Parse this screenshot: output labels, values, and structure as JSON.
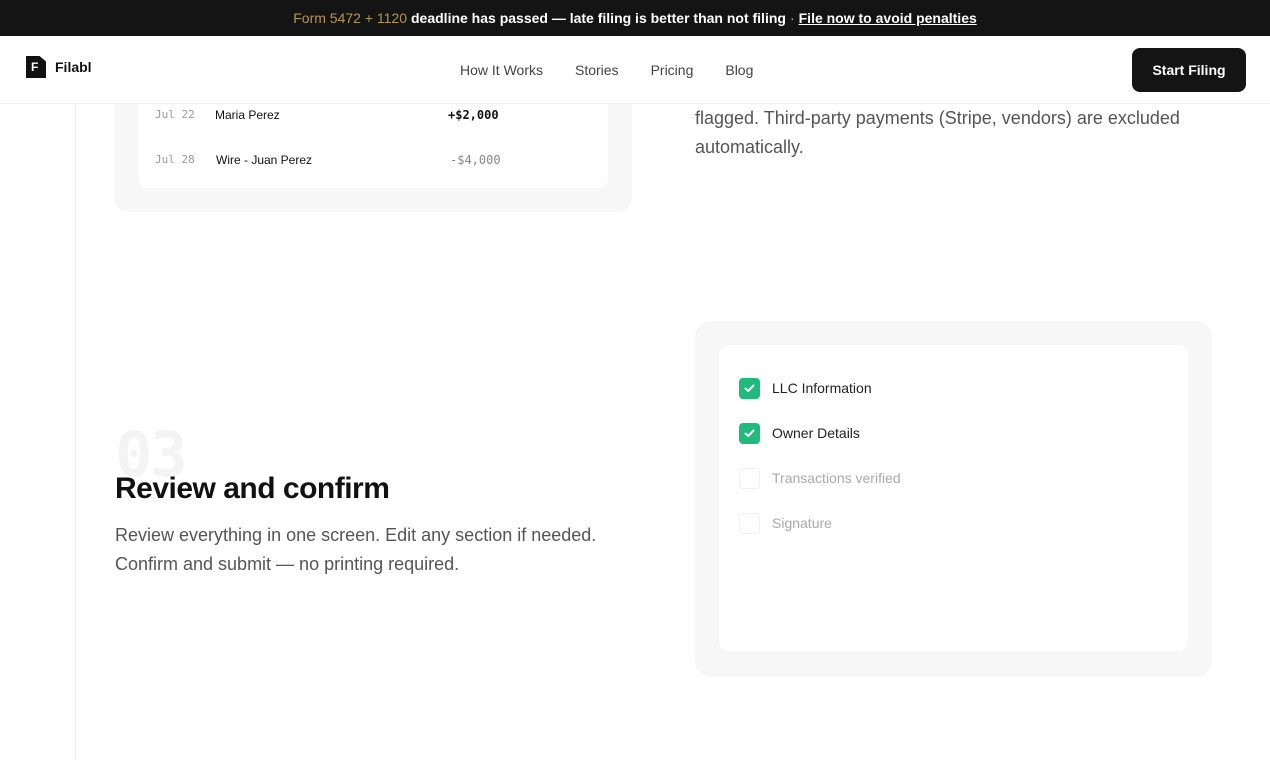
{
  "banner": {
    "form_numbers": "Form 5472 + 1120",
    "message": "deadline has passed — late filing is better than not filing",
    "separator": "·",
    "cta": "File now to avoid penalties"
  },
  "header": {
    "logo_glyph": "F",
    "logo_text": "Filabl",
    "nav": [
      "How It Works",
      "Stories",
      "Pricing",
      "Blog"
    ],
    "cta": "Start Filing"
  },
  "transactions": [
    {
      "date": "Jul 22",
      "name": "Maria Perez",
      "amount": "+$2,000",
      "direction": "in"
    },
    {
      "date": "Jul 28",
      "name": "Wire - Juan Perez",
      "amount": "-$4,000",
      "direction": "out"
    }
  ],
  "excerpt": "flagged. Third-party payments (Stripe, vendors) are excluded automatically.",
  "step": {
    "number": "03",
    "title": "Review and confirm",
    "description": "Review everything in one screen. Edit any section if needed. Confirm and submit — no printing required."
  },
  "checklist": [
    {
      "label": "LLC Information",
      "checked": true
    },
    {
      "label": "Owner Details",
      "checked": true
    },
    {
      "label": "Transactions verified",
      "checked": false
    },
    {
      "label": "Signature",
      "checked": false
    }
  ],
  "colors": {
    "banner_bg": "#141414",
    "accent_gold": "#b89452",
    "check_green": "#1fba7c",
    "button_bg": "#141414"
  },
  "icons": {
    "logo": "document-logo-icon",
    "check": "checkmark-icon"
  }
}
